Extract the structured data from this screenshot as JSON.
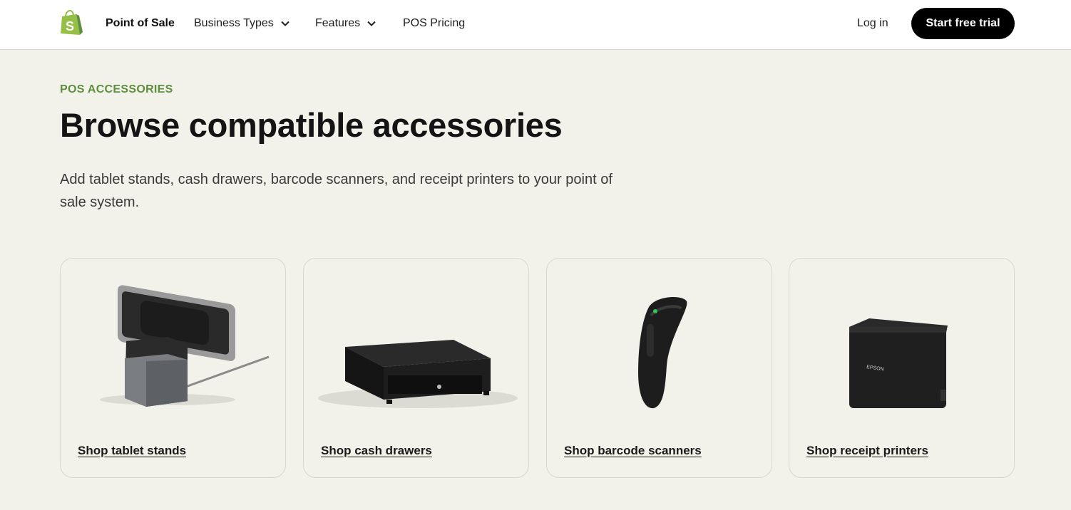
{
  "nav": {
    "logo_icon": "shopify-bag-icon",
    "brand_label": "Point of Sale",
    "business_types_label": "Business Types",
    "features_label": "Features",
    "pricing_label": "POS Pricing",
    "login_label": "Log in",
    "cta_label": "Start free trial"
  },
  "hero": {
    "eyebrow": "POS ACCESSORIES",
    "title": "Browse compatible accessories",
    "description": "Add tablet stands, cash drawers, barcode scanners, and receipt printers to your point of sale system."
  },
  "cards": [
    {
      "link": "Shop tablet stands",
      "image": "tablet-stand"
    },
    {
      "link": "Shop cash drawers",
      "image": "cash-drawer"
    },
    {
      "link": "Shop barcode scanners",
      "image": "barcode-scanner"
    },
    {
      "link": "Shop receipt printers",
      "image": "receipt-printer"
    }
  ],
  "colors": {
    "accent_green": "#5e8e3e",
    "page_bg": "#f2f1ea",
    "cta_bg": "#000000"
  }
}
